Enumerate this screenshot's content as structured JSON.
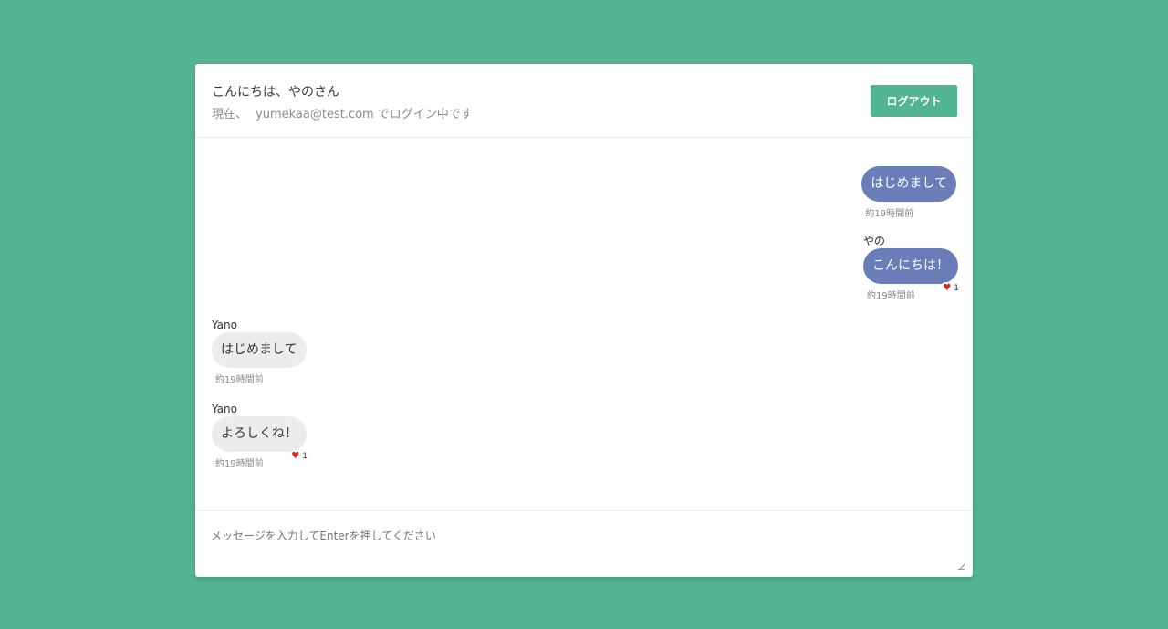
{
  "header": {
    "greeting": "こんにちは、やのさん",
    "status_prefix": "現在、",
    "email": "yumekaa@test.com",
    "status_suffix": "でログイン中です",
    "logout_label": "ログアウト"
  },
  "messages": [
    {
      "side": "me",
      "name": "",
      "text": "はじめまして",
      "time": "約19時間前",
      "likes": ""
    },
    {
      "side": "me",
      "name": "やの",
      "text": "こんにちは！",
      "time": "約19時間前",
      "likes": "1"
    },
    {
      "side": "other",
      "name": "Yano",
      "text": "はじめまして",
      "time": "約19時間前",
      "likes": ""
    },
    {
      "side": "other",
      "name": "Yano",
      "text": "よろしくね！",
      "time": "約19時間前",
      "likes": "1"
    }
  ],
  "composer": {
    "placeholder": "メッセージを入力してEnterを押してください"
  },
  "colors": {
    "background": "#52b490",
    "my_bubble": "#6a7db8",
    "other_bubble": "#ececec",
    "heart": "#e0201f"
  },
  "icons": {
    "like": "heart-icon"
  }
}
